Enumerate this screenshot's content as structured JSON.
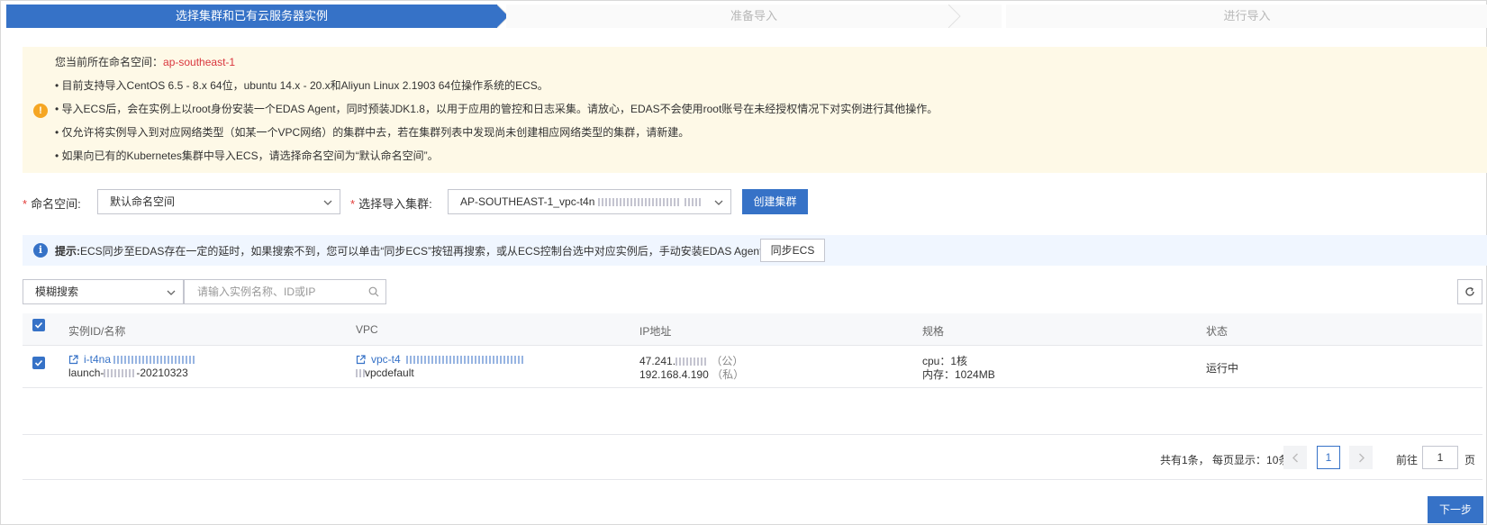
{
  "steps": [
    {
      "label": "选择集群和已有云服务器实例",
      "state": "active"
    },
    {
      "label": "准备导入",
      "state": "pending"
    },
    {
      "label": "进行导入",
      "state": "pending"
    }
  ],
  "notice": {
    "namespace_prefix": "您当前所在命名空间：",
    "namespace_value": "ap-southeast-1",
    "lines": [
      "• 目前支持导入CentOS 6.5 - 8.x 64位，ubuntu 14.x - 20.x和Aliyun Linux 2.1903 64位操作系统的ECS。",
      "• 导入ECS后，会在实例上以root身份安装一个EDAS Agent，同时预装JDK1.8，以用于应用的管控和日志采集。请放心，EDAS不会使用root账号在未经授权情况下对实例进行其他操作。",
      "• 仅允许将实例导入到对应网络类型（如某一个VPC网络）的集群中去，若在集群列表中发现尚未创建相应网络类型的集群，请新建。",
      "• 如果向已有的Kubernetes集群中导入ECS，请选择命名空间为“默认命名空间”。"
    ],
    "icon": "warning-icon"
  },
  "form": {
    "namespace_label": "命名空间:",
    "namespace_value": "默认命名空间",
    "cluster_label": "选择导入集群:",
    "cluster_value": "AP-SOUTHEAST-1_vpc-t4n",
    "create_cluster_label": "创建集群",
    "required_mark": "*"
  },
  "tip": {
    "prefix": "提示:",
    "text": "ECS同步至EDAS存在一定的延时，如果搜索不到，您可以单击“同步ECS”按钮再搜索，或从ECS控制台选中对应实例后，手动安装EDAS Agent。",
    "sync_label": "同步ECS",
    "icon": "info-icon"
  },
  "search": {
    "mode": "模糊搜索",
    "placeholder": "请输入实例名称、ID或IP"
  },
  "table": {
    "columns": [
      "实例ID/名称",
      "VPC",
      "IP地址",
      "规格",
      "状态"
    ],
    "rows": [
      {
        "checked": true,
        "instance_id": "i-t4na",
        "instance_name_prefix": "launch-",
        "instance_name_suffix": "-20210323",
        "vpc_id": "vpc-t4",
        "vpc_name": "vpcdefault",
        "public_ip": "47.241.",
        "public_tag": "（公）",
        "private_ip": "192.168.4.190",
        "private_tag": "（私）",
        "cpu": "cpu：1核",
        "memory": "内存：1024MB",
        "status": "运行中"
      }
    ]
  },
  "pagination": {
    "summary": "共有1条，",
    "per_page": "每页显示：10条",
    "current": "1",
    "goto_label": "前往",
    "goto_value": "1",
    "page_suffix": "页"
  },
  "footer": {
    "next_label": "下一步"
  },
  "colors": {
    "primary": "#3672c7",
    "warning_bg": "#fef9e7",
    "info_bg": "#f0f6ff",
    "namespace_red": "#d9363e"
  }
}
